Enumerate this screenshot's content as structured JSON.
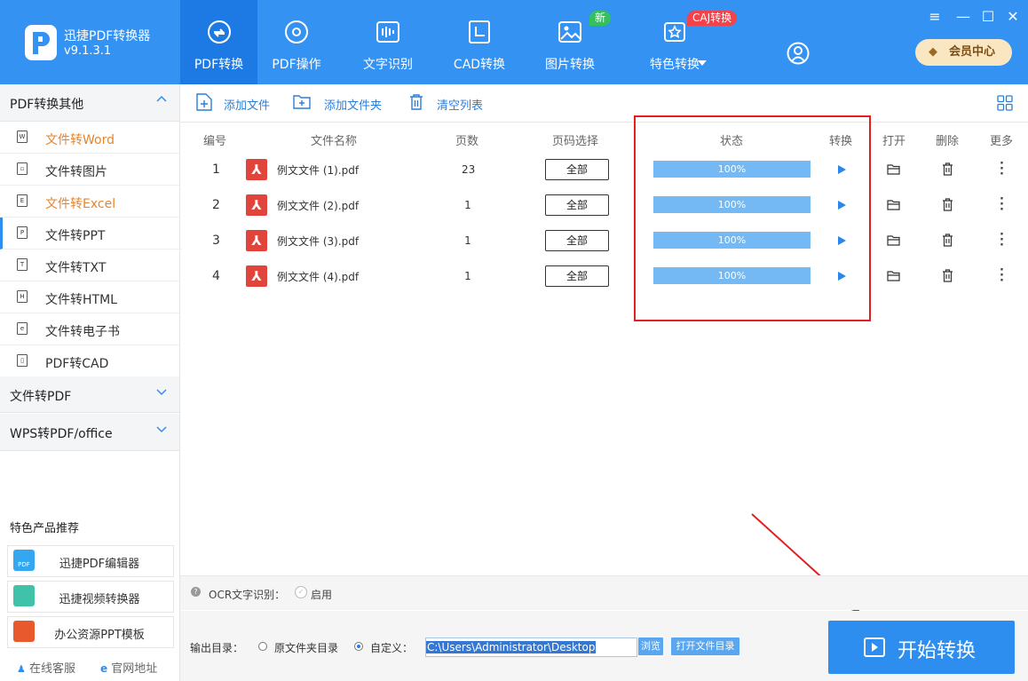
{
  "app": {
    "name": "迅捷PDF转换器",
    "version": "v9.1.3.1"
  },
  "nav": [
    {
      "label": "PDF转换",
      "icon": "pdf-convert-icon",
      "active": true
    },
    {
      "label": "PDF操作",
      "icon": "pdf-operate-icon"
    },
    {
      "label": "文字识别",
      "icon": "text-recognition-icon"
    },
    {
      "label": "CAD转换",
      "icon": "cad-convert-icon"
    },
    {
      "label": "图片转换",
      "icon": "image-convert-icon",
      "badge": "新"
    },
    {
      "label": "特色转换",
      "icon": "special-convert-icon",
      "badge": "CAJ转换"
    }
  ],
  "vip_label": "会员中心",
  "colors": {
    "brand": "#3492f3",
    "nav_active": "#1d7ae4",
    "accent_orange": "#e8842b",
    "progress": "#74b9f4",
    "annotation": "#e02020"
  },
  "sidebar": {
    "group_open": "PDF转换其他",
    "items": [
      {
        "label": "文件转Word",
        "icon": "word-file-icon",
        "glyph": "W"
      },
      {
        "label": "文件转图片",
        "icon": "image-file-icon",
        "glyph": "▫"
      },
      {
        "label": "文件转Excel",
        "icon": "excel-file-icon",
        "glyph": "E"
      },
      {
        "label": "文件转PPT",
        "icon": "ppt-file-icon",
        "glyph": "P",
        "selected": true
      },
      {
        "label": "文件转TXT",
        "icon": "txt-file-icon",
        "glyph": "T"
      },
      {
        "label": "文件转HTML",
        "icon": "html-file-icon",
        "glyph": "H"
      },
      {
        "label": "文件转电子书",
        "icon": "ebook-file-icon",
        "glyph": "e"
      },
      {
        "label": "PDF转CAD",
        "icon": "cad-file-icon",
        "glyph": "▯"
      }
    ],
    "group2": "文件转PDF",
    "group3": "WPS转PDF/office",
    "featured_title": "特色产品推荐",
    "products": [
      {
        "label": "迅捷PDF编辑器",
        "icon": "pdf-editor-icon"
      },
      {
        "label": "迅捷视频转换器",
        "icon": "video-converter-icon"
      },
      {
        "label": "办公资源PPT模板",
        "icon": "ppt-template-icon"
      }
    ],
    "footer": {
      "service": "在线客服",
      "website": "官网地址"
    }
  },
  "toolbar": {
    "add_file": "添加文件",
    "add_folder": "添加文件夹",
    "clear_list": "清空列表"
  },
  "table": {
    "headers": {
      "no": "编号",
      "name": "文件名称",
      "pages": "页数",
      "range": "页码选择",
      "status": "状态",
      "convert": "转换",
      "open": "打开",
      "delete": "删除",
      "more": "更多"
    },
    "rows": [
      {
        "no": "1",
        "name": "例文文件 (1).pdf",
        "pages": "23",
        "range": "全部",
        "progress": 100,
        "status": "100%"
      },
      {
        "no": "2",
        "name": "例文文件 (2).pdf",
        "pages": "1",
        "range": "全部",
        "progress": 100,
        "status": "100%"
      },
      {
        "no": "3",
        "name": "例文文件 (3).pdf",
        "pages": "1",
        "range": "全部",
        "progress": 100,
        "status": "100%"
      },
      {
        "no": "4",
        "name": "例文文件 (4).pdf",
        "pages": "1",
        "range": "全部",
        "progress": 100,
        "status": "100%"
      }
    ]
  },
  "ocr": {
    "label": "OCR文字识别：",
    "enable": "启用"
  },
  "output": {
    "label": "输出目录：",
    "opt_source": "原文件夹目录",
    "opt_custom": "自定义：",
    "path": "C:\\Users\\Administrator\\Desktop",
    "browse": "浏览",
    "open_dir": "打开文件目录"
  },
  "start_label": "开始转换"
}
